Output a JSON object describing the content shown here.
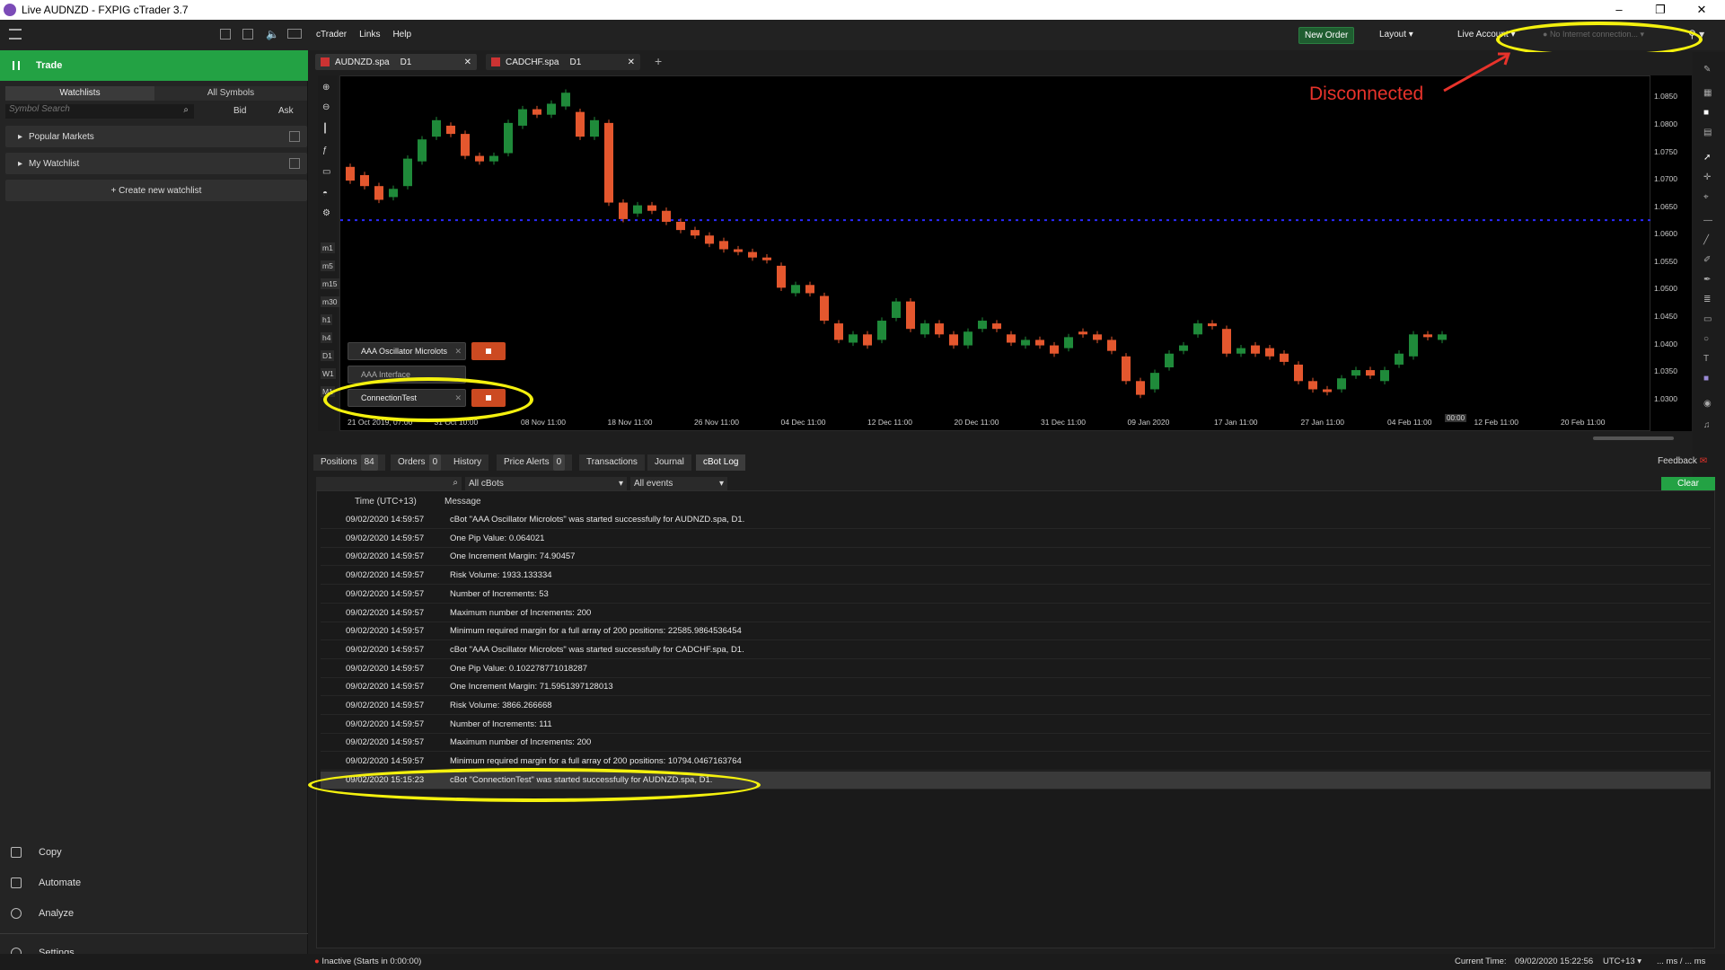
{
  "window": {
    "title": "Live AUDNZD - FXPIG cTrader 3.7",
    "minimize": "–",
    "restore": "❐",
    "close": "✕"
  },
  "menu": {
    "items": [
      "cTrader",
      "Links",
      "Help"
    ],
    "new_order": "New Order",
    "layout": "Layout",
    "live_account": "Live Account",
    "connection": "No Internet connection..."
  },
  "sidebar": {
    "trade": "Trade",
    "tabs": [
      "Watchlists",
      "All Symbols"
    ],
    "search_placeholder": "Symbol Search",
    "bid": "Bid",
    "ask": "Ask",
    "groups": [
      "Popular Markets",
      "My Watchlist"
    ],
    "create": "+ Create new watchlist",
    "nav": [
      "Copy",
      "Automate",
      "Analyze",
      "Settings"
    ]
  },
  "chart_tabs": [
    {
      "symbol": "AUDNZD.spa",
      "tf": "D1"
    },
    {
      "symbol": "CADCHF.spa",
      "tf": "D1"
    }
  ],
  "chart": {
    "annotation": "Disconnected",
    "yticks": [
      "1.0850",
      "1.0800",
      "1.0750",
      "1.0700",
      "1.0650",
      "1.0600",
      "1.0550",
      "1.0500",
      "1.0450",
      "1.0400",
      "1.0350",
      "1.0300"
    ],
    "xticks": [
      "21 Oct 2019, 07:00",
      "31 Oct 10:00",
      "08 Nov 11:00",
      "18 Nov 11:00",
      "26 Nov 11:00",
      "04 Dec 11:00",
      "12 Dec 11:00",
      "20 Dec 11:00",
      "31 Dec 11:00",
      "09 Jan 2020",
      "17 Jan 11:00",
      "27 Jan 11:00",
      "04 Feb 11:00",
      "12 Feb 11:00",
      "20 Feb 11:00"
    ],
    "cursor_time": "00:00",
    "bots": [
      "AAA Oscillator Microlots",
      "AAA Interface",
      "ConnectionTest"
    ],
    "left_tools": [
      "m1",
      "m5",
      "m15",
      "m30",
      "h1",
      "h4",
      "D1",
      "W1",
      "M1"
    ]
  },
  "chart_data": {
    "type": "candlestick",
    "ylim": [
      1.0275,
      1.088
    ],
    "dotted_level": 1.0628,
    "candles": [
      [
        1.0725,
        1.07
      ],
      [
        1.071,
        1.069
      ],
      [
        1.069,
        1.0665
      ],
      [
        1.067,
        1.0685
      ],
      [
        1.069,
        1.074
      ],
      [
        1.0735,
        1.0775
      ],
      [
        1.078,
        1.081
      ],
      [
        1.08,
        1.0785
      ],
      [
        1.0785,
        1.0745
      ],
      [
        1.0745,
        1.0735
      ],
      [
        1.0735,
        1.0745
      ],
      [
        1.075,
        1.0805
      ],
      [
        1.08,
        1.083
      ],
      [
        1.083,
        1.082
      ],
      [
        1.082,
        1.084
      ],
      [
        1.0835,
        1.086
      ],
      [
        1.0825,
        1.078
      ],
      [
        1.078,
        1.081
      ],
      [
        1.0805,
        1.066
      ],
      [
        1.066,
        1.063
      ],
      [
        1.064,
        1.0655
      ],
      [
        1.0655,
        1.0645
      ],
      [
        1.0645,
        1.0625
      ],
      [
        1.0625,
        1.061
      ],
      [
        1.061,
        1.06
      ],
      [
        1.06,
        1.0585
      ],
      [
        1.059,
        1.0575
      ],
      [
        1.0575,
        1.057
      ],
      [
        1.057,
        1.056
      ],
      [
        1.056,
        1.0555
      ],
      [
        1.0545,
        1.0505
      ],
      [
        1.0495,
        1.051
      ],
      [
        1.051,
        1.0495
      ],
      [
        1.049,
        1.0445
      ],
      [
        1.044,
        1.041
      ],
      [
        1.0405,
        1.042
      ],
      [
        1.042,
        1.04
      ],
      [
        1.041,
        1.0445
      ],
      [
        1.045,
        1.048
      ],
      [
        1.048,
        1.043
      ],
      [
        1.042,
        1.044
      ],
      [
        1.044,
        1.042
      ],
      [
        1.042,
        1.04
      ],
      [
        1.04,
        1.0425
      ],
      [
        1.043,
        1.0445
      ],
      [
        1.044,
        1.043
      ],
      [
        1.042,
        1.0405
      ],
      [
        1.04,
        1.041
      ],
      [
        1.041,
        1.04
      ],
      [
        1.04,
        1.0385
      ],
      [
        1.0395,
        1.0415
      ],
      [
        1.0425,
        1.042
      ],
      [
        1.042,
        1.041
      ],
      [
        1.041,
        1.039
      ],
      [
        1.038,
        1.0335
      ],
      [
        1.0335,
        1.031
      ],
      [
        1.032,
        1.035
      ],
      [
        1.036,
        1.0385
      ],
      [
        1.039,
        1.04
      ],
      [
        1.042,
        1.044
      ],
      [
        1.044,
        1.0435
      ],
      [
        1.043,
        1.0385
      ],
      [
        1.0385,
        1.0395
      ],
      [
        1.04,
        1.0385
      ],
      [
        1.0395,
        1.038
      ],
      [
        1.0385,
        1.037
      ],
      [
        1.0365,
        1.0335
      ],
      [
        1.0335,
        1.032
      ],
      [
        1.032,
        1.0315
      ],
      [
        1.032,
        1.034
      ],
      [
        1.0345,
        1.0355
      ],
      [
        1.0355,
        1.0345
      ],
      [
        1.0335,
        1.0355
      ],
      [
        1.0365,
        1.0385
      ],
      [
        1.038,
        1.042
      ],
      [
        1.042,
        1.0415
      ],
      [
        1.041,
        1.042
      ]
    ]
  },
  "bottom": {
    "tabs": [
      {
        "label": "Positions",
        "count": "84"
      },
      {
        "label": "Orders",
        "count": "0"
      },
      {
        "label": "History",
        "count": ""
      },
      {
        "label": "Price Alerts",
        "count": "0"
      },
      {
        "label": "Transactions",
        "count": ""
      },
      {
        "label": "Journal",
        "count": ""
      },
      {
        "label": "cBot Log",
        "count": ""
      }
    ],
    "feedback": "Feedback",
    "filter_bots": "All cBots",
    "filter_events": "All events",
    "clear": "Clear",
    "col_time": "Time (UTC+13)",
    "col_message": "Message",
    "rows": [
      {
        "time": "09/02/2020 14:59:57",
        "message": "cBot \"AAA Oscillator Microlots\" was started successfully for AUDNZD.spa, D1."
      },
      {
        "time": "09/02/2020 14:59:57",
        "message": "One Pip Value: 0.064021"
      },
      {
        "time": "09/02/2020 14:59:57",
        "message": "One Increment Margin: 74.90457"
      },
      {
        "time": "09/02/2020 14:59:57",
        "message": "Risk Volume: 1933.133334"
      },
      {
        "time": "09/02/2020 14:59:57",
        "message": "Number of Increments: 53"
      },
      {
        "time": "09/02/2020 14:59:57",
        "message": "Maximum number of Increments: 200"
      },
      {
        "time": "09/02/2020 14:59:57",
        "message": "Minimum required margin for a full array of 200 positions: 22585.9864536454"
      },
      {
        "time": "09/02/2020 14:59:57",
        "message": "cBot \"AAA Oscillator Microlots\" was started successfully for CADCHF.spa, D1."
      },
      {
        "time": "09/02/2020 14:59:57",
        "message": "One Pip Value: 0.102278771018287"
      },
      {
        "time": "09/02/2020 14:59:57",
        "message": "One Increment Margin: 71.5951397128013"
      },
      {
        "time": "09/02/2020 14:59:57",
        "message": "Risk Volume: 3866.266668"
      },
      {
        "time": "09/02/2020 14:59:57",
        "message": "Number of Increments: 111"
      },
      {
        "time": "09/02/2020 14:59:57",
        "message": "Maximum number of Increments: 200"
      },
      {
        "time": "09/02/2020 14:59:57",
        "message": "Minimum required margin for a full array of 200 positions: 10794.0467163764"
      },
      {
        "time": "09/02/2020 15:15:23",
        "message": "cBot \"ConnectionTest\" was started successfully for AUDNZD.spa, D1."
      }
    ]
  },
  "status": {
    "left": "Inactive (Starts in 0:00:00)",
    "current_time_label": "Current Time:",
    "current_time": "09/02/2020 15:22:56",
    "tz": "UTC+13",
    "latency": "... ms / ... ms"
  },
  "colors": {
    "bull": "#1f8a3a",
    "bear": "#e4572e",
    "accent": "#23a244",
    "annotation": "#e8332b",
    "highlight": "#f4f10e"
  }
}
